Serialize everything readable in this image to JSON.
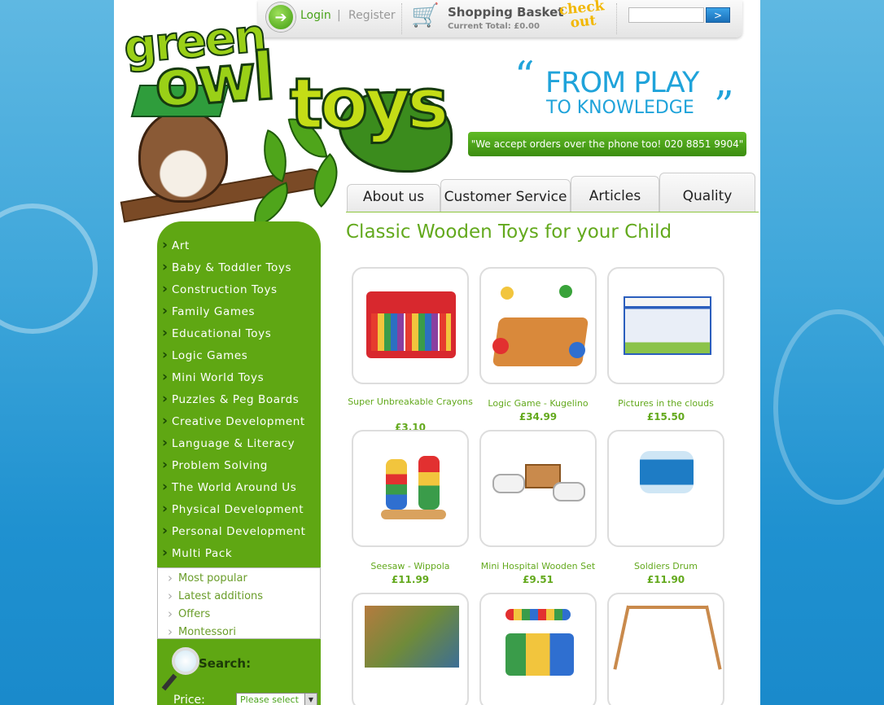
{
  "header": {
    "login_label": "Login",
    "separator": "|",
    "register_label": "Register",
    "basket_title": "Shopping Basket",
    "basket_total": "Current Total: £0.00",
    "checkout_line1": "check",
    "checkout_line2": "out",
    "search_button": ">",
    "search_value": ""
  },
  "logo": {
    "word1": "green",
    "word2": "owl",
    "word3": "toys"
  },
  "slogan": {
    "quote_open": "“",
    "line1": "FROM PLAY",
    "line2": "TO KNOWLEDGE",
    "quote_close": "”",
    "phone": "\"We accept orders over the phone too! 020 8851 9904\""
  },
  "tabs": [
    {
      "label": "About us"
    },
    {
      "label": "Customer Service"
    },
    {
      "label": "Articles"
    },
    {
      "label": "Quality"
    }
  ],
  "main": {
    "title": "Classic Wooden Toys for your Child"
  },
  "sidebar": {
    "categories": [
      "Art",
      "Baby & Toddler Toys",
      "Construction Toys",
      "Family Games",
      "Educational Toys",
      "Logic Games",
      "Mini World Toys",
      "Puzzles & Peg Boards",
      "Creative Development",
      "Language & Literacy",
      "Problem Solving",
      "The World Around Us",
      "Physical Development",
      "Personal Development",
      "Multi Pack"
    ],
    "sub_links": [
      "Most popular",
      "Latest additions",
      "Offers",
      "Montessori"
    ],
    "search_label": "Search:",
    "price_label": "Price:",
    "price_select": "Please select"
  },
  "products": [
    {
      "name": "Super Unbreakable Crayons",
      "price": "£3.10"
    },
    {
      "name": "Logic Game - Kugelino",
      "price": "£34.99"
    },
    {
      "name": "Pictures in the clouds",
      "price": "£15.50"
    },
    {
      "name": "Seesaw - Wippola",
      "price": "£11.99"
    },
    {
      "name": "Mini Hospital Wooden Set",
      "price": "£9.51"
    },
    {
      "name": "Soldiers Drum",
      "price": "£11.90"
    },
    {
      "name": "",
      "price": ""
    },
    {
      "name": "",
      "price": ""
    },
    {
      "name": "",
      "price": ""
    }
  ],
  "icons": {
    "login": "arrow-right-circle-icon",
    "cart": "shopping-cart-icon",
    "search": "magnifier-icon",
    "bullet": "chevron-right-icon"
  },
  "colors": {
    "brand_green": "#5fa713",
    "title_green": "#63a91d",
    "slogan_blue": "#1fa3da",
    "checkout_yellow": "#f2b700",
    "background_blue": "#3ea6da"
  }
}
